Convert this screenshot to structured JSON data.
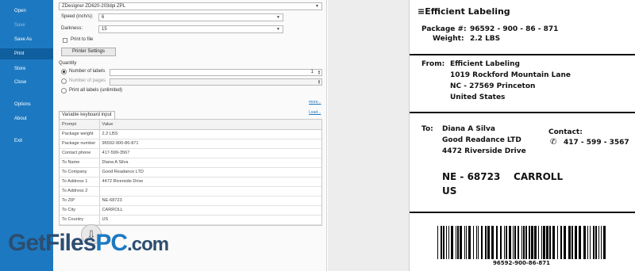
{
  "sidebar": {
    "items": [
      {
        "label": "Open"
      },
      {
        "label": "Save"
      },
      {
        "label": "Save As"
      },
      {
        "label": "Print"
      },
      {
        "label": "Store"
      },
      {
        "label": "Close"
      },
      {
        "label": "Options"
      },
      {
        "label": "About"
      },
      {
        "label": "Exit"
      }
    ]
  },
  "print": {
    "printer": "ZDesigner ZD620-203dpi ZPL",
    "speed_label": "Speed (inch/s):",
    "speed_value": "6",
    "darkness_label": "Darkness:",
    "darkness_value": "15",
    "print_to_file": "Print to file",
    "printer_settings": "Printer Settings",
    "quantity_label": "Quantity",
    "number_of_labels": "Number of labels",
    "number_of_labels_value": "1",
    "number_of_pages": "Number of pages",
    "print_all": "Print all labels (unlimited)",
    "more": "more...",
    "load": "Load..."
  },
  "vars": {
    "tab": "Variable keyboard input",
    "col_prompt": "Prompt",
    "col_value": "Value",
    "rows": [
      {
        "prompt": "Package weight",
        "value": "2.2 LBS"
      },
      {
        "prompt": "Package number",
        "value": "96592-900-86-871"
      },
      {
        "prompt": "Contact phone",
        "value": "417-599-3567"
      },
      {
        "prompt": "To Name",
        "value": "Diana A Silva"
      },
      {
        "prompt": "To Company",
        "value": "Good Readance LTD"
      },
      {
        "prompt": "To Address 1",
        "value": "4472  Riverside Drive"
      },
      {
        "prompt": "To Address 2",
        "value": ""
      },
      {
        "prompt": "To ZIP",
        "value": "NE-68723"
      },
      {
        "prompt": "To City",
        "value": "CARROLL"
      },
      {
        "prompt": "To Country",
        "value": "US"
      }
    ]
  },
  "label": {
    "brand": "Efficient Labeling",
    "package_key": "Package #:",
    "package_val": "96592 - 900 - 86 - 871",
    "weight_key": "Weight:",
    "weight_val": "2.2 LBS",
    "from_key": "From:",
    "from_lines": [
      "Efficient Labeling",
      "1019  Rockford Mountain Lane",
      "NC - 27569 Princeton",
      "United States"
    ],
    "to_key": "To:",
    "to_lines": [
      "Diana A Silva",
      "Good Readance LTD",
      "4472  Riverside Drive"
    ],
    "contact_key": "Contact:",
    "contact_val": "417 - 599 - 3567",
    "zip_city": "NE - 68723    CARROLL",
    "country": "US",
    "barcode_text": "96592-900-86-871"
  },
  "watermark": {
    "part1": "GetFiles",
    "part2": "PC",
    "part3": ".com"
  },
  "icons": {
    "phone": "phone-icon",
    "menu": "menu-lines-icon",
    "download": "download-icon"
  },
  "colors": {
    "sidebar": "#1c79c1",
    "sidebar_active": "#0f5e9e"
  }
}
